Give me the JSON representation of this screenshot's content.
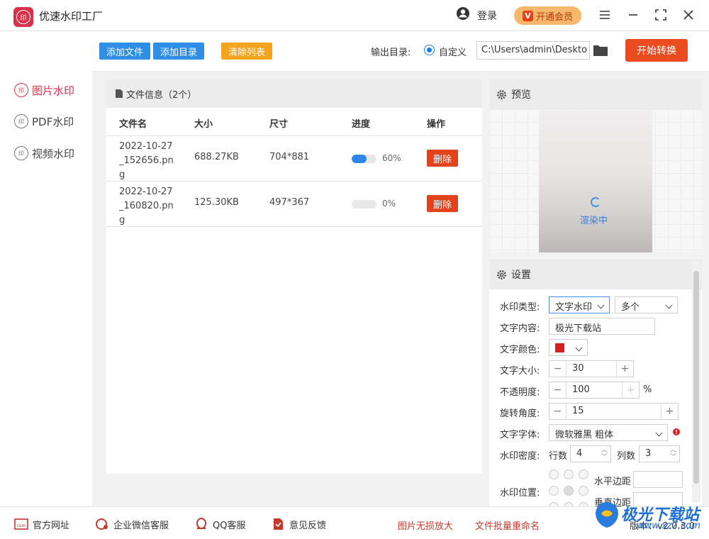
{
  "app": {
    "title": "优速水印工厂",
    "logo_text": "印"
  },
  "titlebar": {
    "login": "登录",
    "vip": "开通会员",
    "vip_badge": "V"
  },
  "sidebar": {
    "items": [
      {
        "label": "图片水印",
        "icon": "印",
        "active": true
      },
      {
        "label": "PDF水印",
        "icon": "印",
        "active": false
      },
      {
        "label": "视频水印",
        "icon": "印",
        "active": false
      }
    ]
  },
  "toolbar": {
    "add_file": "添加文件",
    "add_dir": "添加目录",
    "clear_list": "清除列表",
    "output_label": "输出目录:",
    "radio_label": "自定义",
    "output_path": "C:\\Users\\admin\\Deskto",
    "start": "开始转换",
    "colors": {
      "blue": "#2e8ee6",
      "orange": "#f5a21c",
      "red": "#ea4b1f"
    }
  },
  "files": {
    "header": "文件信息（2个）",
    "columns": [
      "文件名",
      "大小",
      "尺寸",
      "进度",
      "操作"
    ],
    "rows": [
      {
        "name": "2022-10-27_152656.png",
        "size": "688.27KB",
        "dims": "704*881",
        "progress": 60,
        "progress_text": "60%",
        "action": "删除"
      },
      {
        "name": "2022-10-27_160820.png",
        "size": "125.30KB",
        "dims": "497*367",
        "progress": 0,
        "progress_text": "0%",
        "action": "删除"
      }
    ]
  },
  "preview": {
    "title": "预览",
    "status": "渲染中"
  },
  "settings": {
    "title": "设置",
    "watermark_type_label": "水印类型:",
    "watermark_type": "文字水印",
    "watermark_count": "多个",
    "text_content_label": "文字内容:",
    "text_content": "极光下载站",
    "text_color_label": "文字颜色:",
    "text_color": "#d42020",
    "text_size_label": "文字大小:",
    "text_size": "30",
    "opacity_label": "不透明度:",
    "opacity": "100",
    "opacity_unit": "%",
    "rotation_label": "旋转角度:",
    "rotation": "15",
    "font_label": "文字字体:",
    "font": "微软雅黑 粗体",
    "density_label": "水印密度:",
    "rows_label": "行数",
    "rows": "4",
    "cols_label": "列数",
    "cols": "3",
    "position_label": "水印位置:",
    "h_margin_label": "水平边距",
    "v_margin_label": "垂直边距"
  },
  "footer": {
    "website": "官方网址",
    "wechat": "企业微信客服",
    "qq": "QQ客服",
    "feedback": "意见反馈",
    "upscale": "图片无损放大",
    "rename": "文件批量重命名",
    "version": "版本：v2.0.3.0"
  },
  "watermark": {
    "brand": "极光下载站",
    "url": "www.xz7.com"
  }
}
